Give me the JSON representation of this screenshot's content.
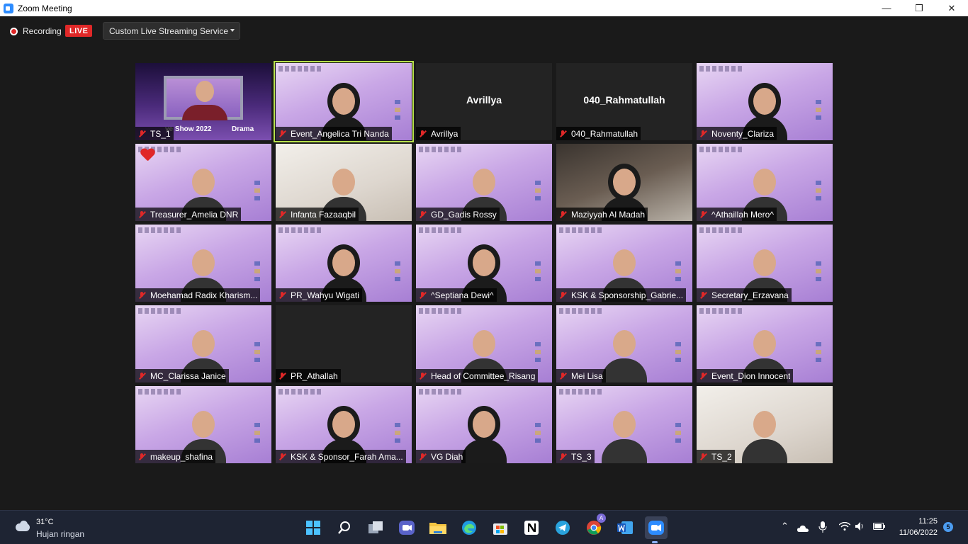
{
  "window": {
    "title": "Zoom Meeting"
  },
  "recording": {
    "label": "Recording",
    "live_badge": "LIVE",
    "streaming_service": "Custom Live Streaming Service"
  },
  "participants": [
    {
      "name": "TS_1",
      "muted": true,
      "video": "stage"
    },
    {
      "name": "Event_Angelica Tri Nanda",
      "muted": true,
      "video": "on",
      "active_speaker": true
    },
    {
      "name": "Avrillya",
      "muted": true,
      "video": "off",
      "display_name": "Avrillya"
    },
    {
      "name": "040_Rahmatullah",
      "muted": true,
      "video": "off",
      "display_name": "040_Rahmatullah"
    },
    {
      "name": "Noventy_Clariza",
      "muted": true,
      "video": "on"
    },
    {
      "name": "Treasurer_Amelia DNR",
      "muted": true,
      "video": "on",
      "reaction": "heart"
    },
    {
      "name": "Infanta Fazaaqbil",
      "muted": true,
      "video": "on"
    },
    {
      "name": "GD_Gadis Rossy",
      "muted": true,
      "video": "on"
    },
    {
      "name": "Maziyyah Al Madah",
      "muted": true,
      "video": "on"
    },
    {
      "name": "^Athaillah Mero^",
      "muted": true,
      "video": "on"
    },
    {
      "name": "Moehamad Radix Kharism...",
      "muted": true,
      "video": "on"
    },
    {
      "name": "PR_Wahyu Wigati",
      "muted": true,
      "video": "on"
    },
    {
      "name": "^Septiana Dewi^",
      "muted": true,
      "video": "on"
    },
    {
      "name": "KSK & Sponsorship_Gabrie...",
      "muted": true,
      "video": "on"
    },
    {
      "name": "Secretary_Erzavana",
      "muted": true,
      "video": "on"
    },
    {
      "name": "MC_Clarissa Janice",
      "muted": true,
      "video": "on"
    },
    {
      "name": "PR_Athallah",
      "muted": true,
      "video": "off"
    },
    {
      "name": "Head of Committee_Risang",
      "muted": true,
      "video": "on"
    },
    {
      "name": "Mei Lisa",
      "muted": true,
      "video": "on"
    },
    {
      "name": "Event_Dion Innocent",
      "muted": true,
      "video": "on"
    },
    {
      "name": "makeup_shafina",
      "muted": true,
      "video": "on"
    },
    {
      "name": "KSK & Sponsor_Farah Ama...",
      "muted": true,
      "video": "on"
    },
    {
      "name": "VG Diah",
      "muted": true,
      "video": "on"
    },
    {
      "name": "TS_3",
      "muted": true,
      "video": "on"
    },
    {
      "name": "TS_2",
      "muted": true,
      "video": "on"
    }
  ],
  "stage_tile": {
    "caption_left": "ve Show 2022",
    "caption_right": "Drama"
  },
  "taskbar": {
    "weather": {
      "temp": "31°C",
      "desc": "Hujan ringan"
    },
    "clock": {
      "time": "11:25",
      "date": "11/06/2022"
    },
    "notifications": "5",
    "pinned": [
      "start",
      "search",
      "task-view",
      "zoom-chat",
      "file-explorer",
      "edge",
      "store",
      "notion",
      "telegram",
      "chrome",
      "word",
      "zoom"
    ]
  },
  "colors": {
    "accent": "#2D8CFF",
    "live": "#E02828",
    "active_speaker": "#B7E04B"
  }
}
